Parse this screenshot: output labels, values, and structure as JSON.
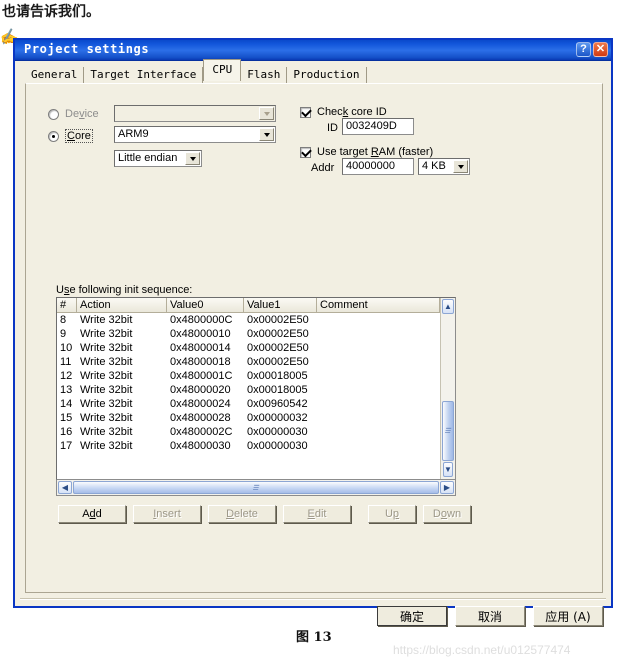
{
  "page": {
    "top_note": "也请告诉我们。",
    "figure_caption": "图 13",
    "watermark": "https://blog.csdn.net/u012577474",
    "cursor_icon": "hand-cursor-icon"
  },
  "dialog": {
    "title": "Project settings",
    "titlebar_buttons": [
      {
        "name": "help-button",
        "glyph": "?"
      },
      {
        "name": "close-button",
        "glyph": "✕"
      }
    ],
    "tabs": [
      {
        "label": "General",
        "active": false
      },
      {
        "label": "Target Interface",
        "active": false
      },
      {
        "label": "CPU",
        "active": true
      },
      {
        "label": "Flash",
        "active": false
      },
      {
        "label": "Production",
        "active": false
      }
    ],
    "cpu_tab": {
      "device": {
        "radio_label": "Device",
        "radio_label_pre": "De",
        "radio_label_accel": "v",
        "radio_label_post": "ice",
        "selected": false,
        "combo_value": "",
        "enabled": false
      },
      "core": {
        "radio_label_pre": "",
        "radio_label_accel": "C",
        "radio_label_post": "ore",
        "selected": true,
        "combo_value": "ARM9"
      },
      "endian": {
        "value": "Little endian"
      },
      "check_core_id": {
        "checked": true,
        "label_pre": "Chec",
        "label_accel": "k",
        "label_post": " core ID",
        "id_label": "ID",
        "id_value": "0032409D"
      },
      "use_target_ram": {
        "checked": true,
        "label_pre": "Use target ",
        "label_accel": "R",
        "label_post": "AM (faster)",
        "addr_label": "Addr",
        "addr_value": "40000000",
        "size_value": "4 KB"
      },
      "init_sequence": {
        "label_pre": "U",
        "label_accel": "s",
        "label_post": "e following init sequence:",
        "columns": [
          "#",
          "Action",
          "Value0",
          "Value1",
          "Comment"
        ],
        "rows": [
          {
            "num": "8",
            "action": "Write 32bit",
            "value0": "0x4800000C",
            "value1": "0x00002E50",
            "comment": ""
          },
          {
            "num": "9",
            "action": "Write 32bit",
            "value0": "0x48000010",
            "value1": "0x00002E50",
            "comment": ""
          },
          {
            "num": "10",
            "action": "Write 32bit",
            "value0": "0x48000014",
            "value1": "0x00002E50",
            "comment": ""
          },
          {
            "num": "11",
            "action": "Write 32bit",
            "value0": "0x48000018",
            "value1": "0x00002E50",
            "comment": ""
          },
          {
            "num": "12",
            "action": "Write 32bit",
            "value0": "0x4800001C",
            "value1": "0x00018005",
            "comment": ""
          },
          {
            "num": "13",
            "action": "Write 32bit",
            "value0": "0x48000020",
            "value1": "0x00018005",
            "comment": ""
          },
          {
            "num": "14",
            "action": "Write 32bit",
            "value0": "0x48000024",
            "value1": "0x00960542",
            "comment": ""
          },
          {
            "num": "15",
            "action": "Write 32bit",
            "value0": "0x48000028",
            "value1": "0x00000032",
            "comment": ""
          },
          {
            "num": "16",
            "action": "Write 32bit",
            "value0": "0x4800002C",
            "value1": "0x00000030",
            "comment": ""
          },
          {
            "num": "17",
            "action": "Write 32bit",
            "value0": "0x48000030",
            "value1": "0x00000030",
            "comment": ""
          }
        ]
      },
      "list_buttons": [
        {
          "pre": "A",
          "accel": "d",
          "post": "d",
          "enabled": true
        },
        {
          "pre": "",
          "accel": "I",
          "post": "nsert",
          "enabled": false
        },
        {
          "pre": "",
          "accel": "D",
          "post": "elete",
          "enabled": false
        },
        {
          "pre": "",
          "accel": "E",
          "post": "dit",
          "enabled": false
        },
        {
          "pre": "U",
          "accel": "p",
          "post": "",
          "enabled": false
        },
        {
          "pre": "D",
          "accel": "o",
          "post": "wn",
          "enabled": false
        }
      ]
    },
    "footer_buttons": [
      {
        "label": "确定",
        "default": true
      },
      {
        "label": "取消",
        "default": false
      },
      {
        "label": "应用 (A)",
        "default": false
      }
    ]
  },
  "colors": {
    "title_blue": "#1155DA",
    "dialog_border": "#0A36C4",
    "dialog_face": "#F2EFE2",
    "scrollbar_blue": "#A6BDE8"
  }
}
